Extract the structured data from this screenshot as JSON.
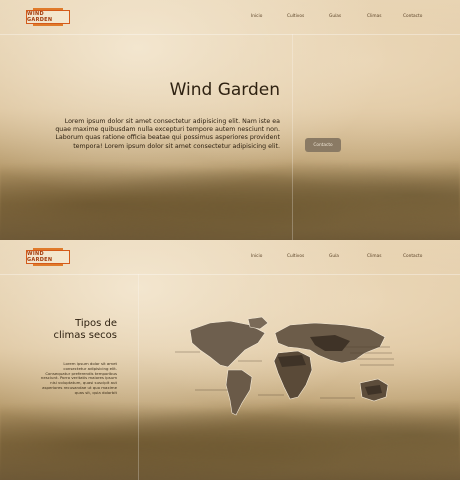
{
  "brand": {
    "logo_text": "WIND GARDEN"
  },
  "nav": {
    "items": [
      "Inicio",
      "Cultivos",
      "Guías",
      "Climas",
      "Contacto"
    ],
    "items_page2": [
      "Inicio",
      "Cultivos",
      "Guía",
      "Climas",
      "Contacto"
    ]
  },
  "hero": {
    "title": "Wind Garden",
    "paragraph": "Lorem ipsum dolor sit amet consectetur adipisicing elit. Nam iste ea quae maxime quibusdam nulla excepturi tempore autem nesciunt non. Laborum quas ratione officia beatae qui possimus asperiores provident tempora! Lorem ipsum dolor sit amet consectetur adipisicing elit.",
    "button_label": "Contacto"
  },
  "climas": {
    "title_line1": "Tipos de",
    "title_line2": "climas secos",
    "paragraph": "Lorem ipsum dolor sit amet consectetur adipisicing elit. Consequatur preferendis temporibus nesciunt. Porro veritatis maiores ipsum nisi voluptatum, quasi suscipit aut asperiores recusandae ut quo maxime quas sit, quia dolorbit"
  },
  "colors": {
    "accent": "#d45a1a",
    "text": "#2f2212",
    "button": "#8a7a64"
  }
}
